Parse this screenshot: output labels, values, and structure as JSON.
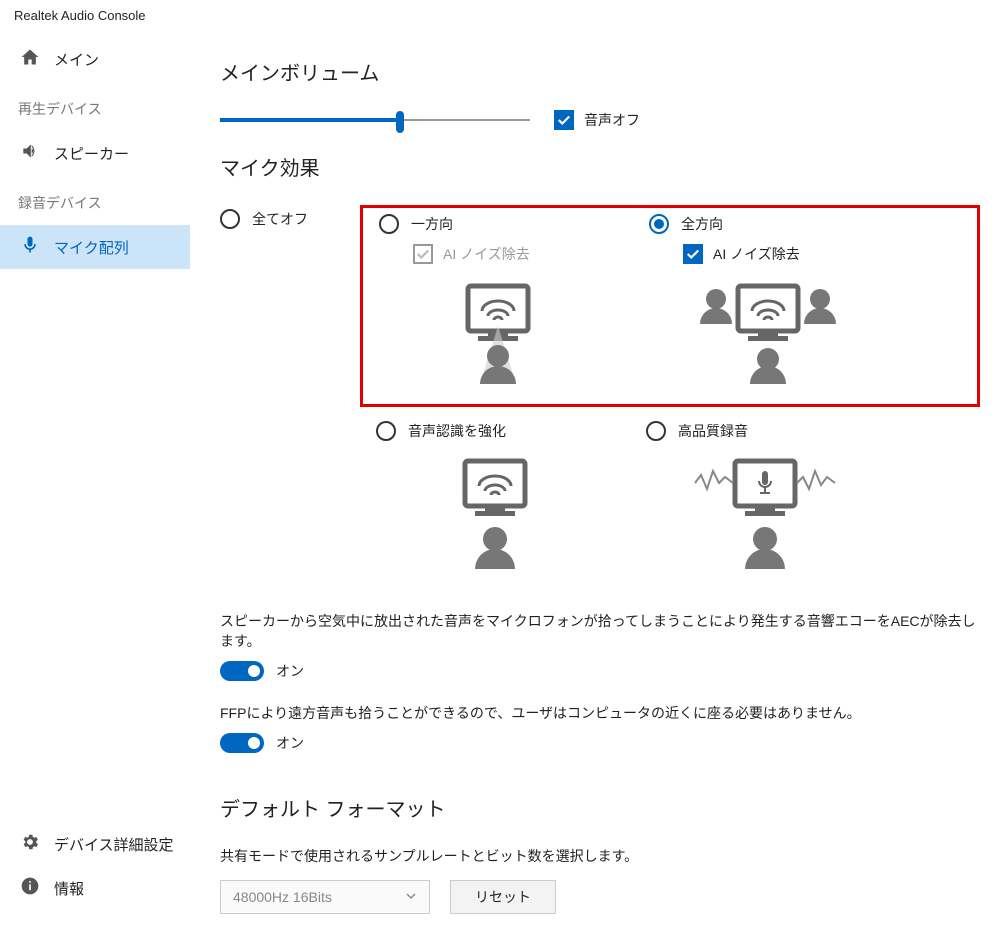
{
  "app_title": "Realtek Audio Console",
  "sidebar": {
    "main": "メイン",
    "playback_header": "再生デバイス",
    "speakers": "スピーカー",
    "recording_header": "録音デバイス",
    "mic_array": "マイク配列",
    "device_settings": "デバイス詳細設定",
    "info": "情報"
  },
  "volume": {
    "title": "メインボリューム",
    "percent": 58,
    "mute_label": "音声オフ"
  },
  "effects": {
    "title": "マイク効果",
    "all_off": "全てオフ",
    "unidirectional": "一方向",
    "omnidirectional": "全方向",
    "ai_noise": "AI ノイズ除去",
    "voice_recognition": "音声認識を強化",
    "hq_recording": "高品質録音"
  },
  "aec": {
    "desc": "スピーカーから空気中に放出された音声をマイクロフォンが拾ってしまうことにより発生する音響エコーをAECが除去します。",
    "state": "オン"
  },
  "ffp": {
    "desc": "FFPにより遠方音声も拾うことができるので、ユーザはコンピュータの近くに座る必要はありません。",
    "state": "オン"
  },
  "format": {
    "title": "デフォルト フォーマット",
    "desc": "共有モードで使用されるサンプルレートとビット数を選択します。",
    "value": "48000Hz 16Bits",
    "reset": "リセット"
  }
}
